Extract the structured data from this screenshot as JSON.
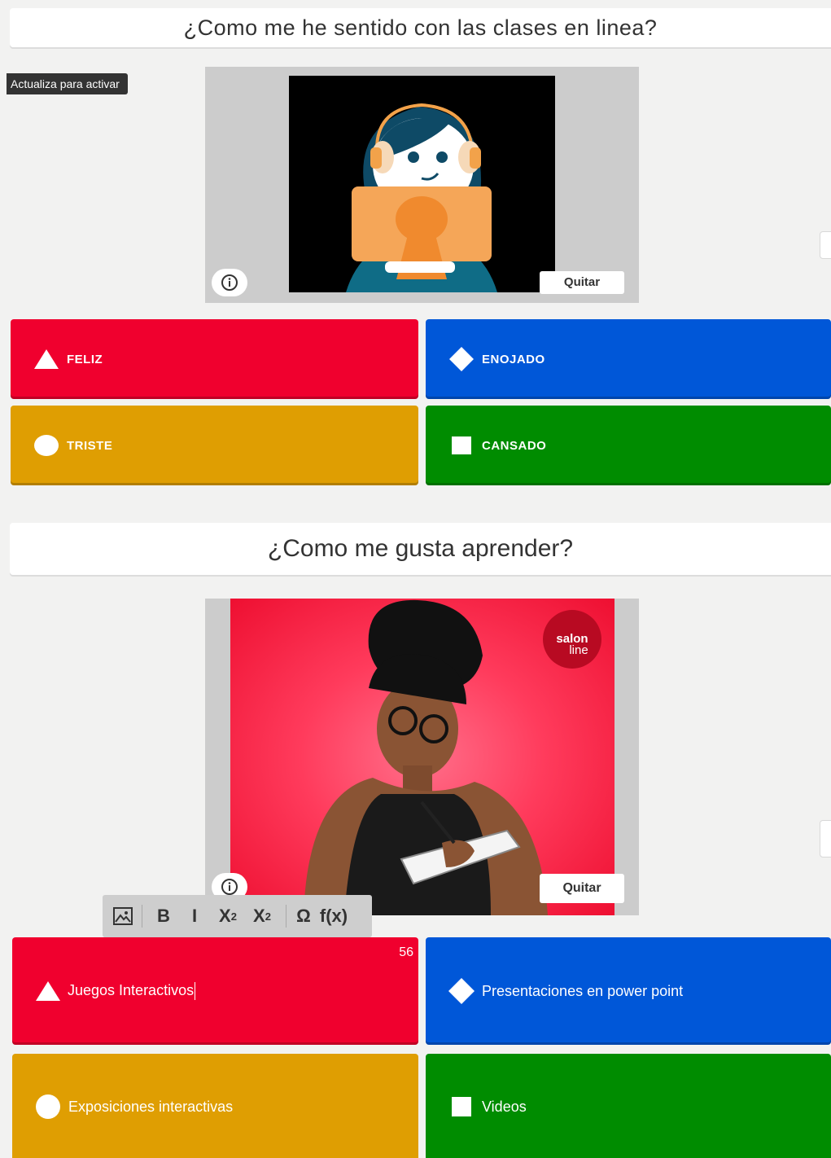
{
  "question1": {
    "title": "¿Como me he sentido con las clases en linea?",
    "update_badge": "Actualiza para activar",
    "remove_label": "Quitar",
    "answers": [
      {
        "label": "FELIZ",
        "shape": "triangle-icon",
        "color": "#f0002e"
      },
      {
        "label": "ENOJADO",
        "shape": "diamond-icon",
        "color": "#0057d8"
      },
      {
        "label": "TRISTE",
        "shape": "circle-icon",
        "color": "#df9e02"
      },
      {
        "label": "CANSADO",
        "shape": "square-icon",
        "color": "#008c00"
      }
    ]
  },
  "question2": {
    "title": "¿Como me gusta aprender?",
    "remove_label": "Quitar",
    "logo_text_1": "salon",
    "logo_text_2": "line",
    "char_counter": "56",
    "answers": [
      {
        "label": "Juegos Interactivos",
        "shape": "triangle-icon",
        "color": "#f0002e"
      },
      {
        "label": "Presentaciones en power point",
        "shape": "diamond-icon",
        "color": "#0057d8"
      },
      {
        "label": "Exposiciones  interactivas",
        "shape": "circle-icon",
        "color": "#df9e02"
      },
      {
        "label": "Videos",
        "shape": "square-icon",
        "color": "#008c00"
      }
    ]
  },
  "toolbar": {
    "bold": "B",
    "italic": "I",
    "subscript_base": "X",
    "subscript_mark": "2",
    "superscript_base": "X",
    "superscript_mark": "2",
    "omega": "Ω",
    "formula": "f(x)"
  }
}
